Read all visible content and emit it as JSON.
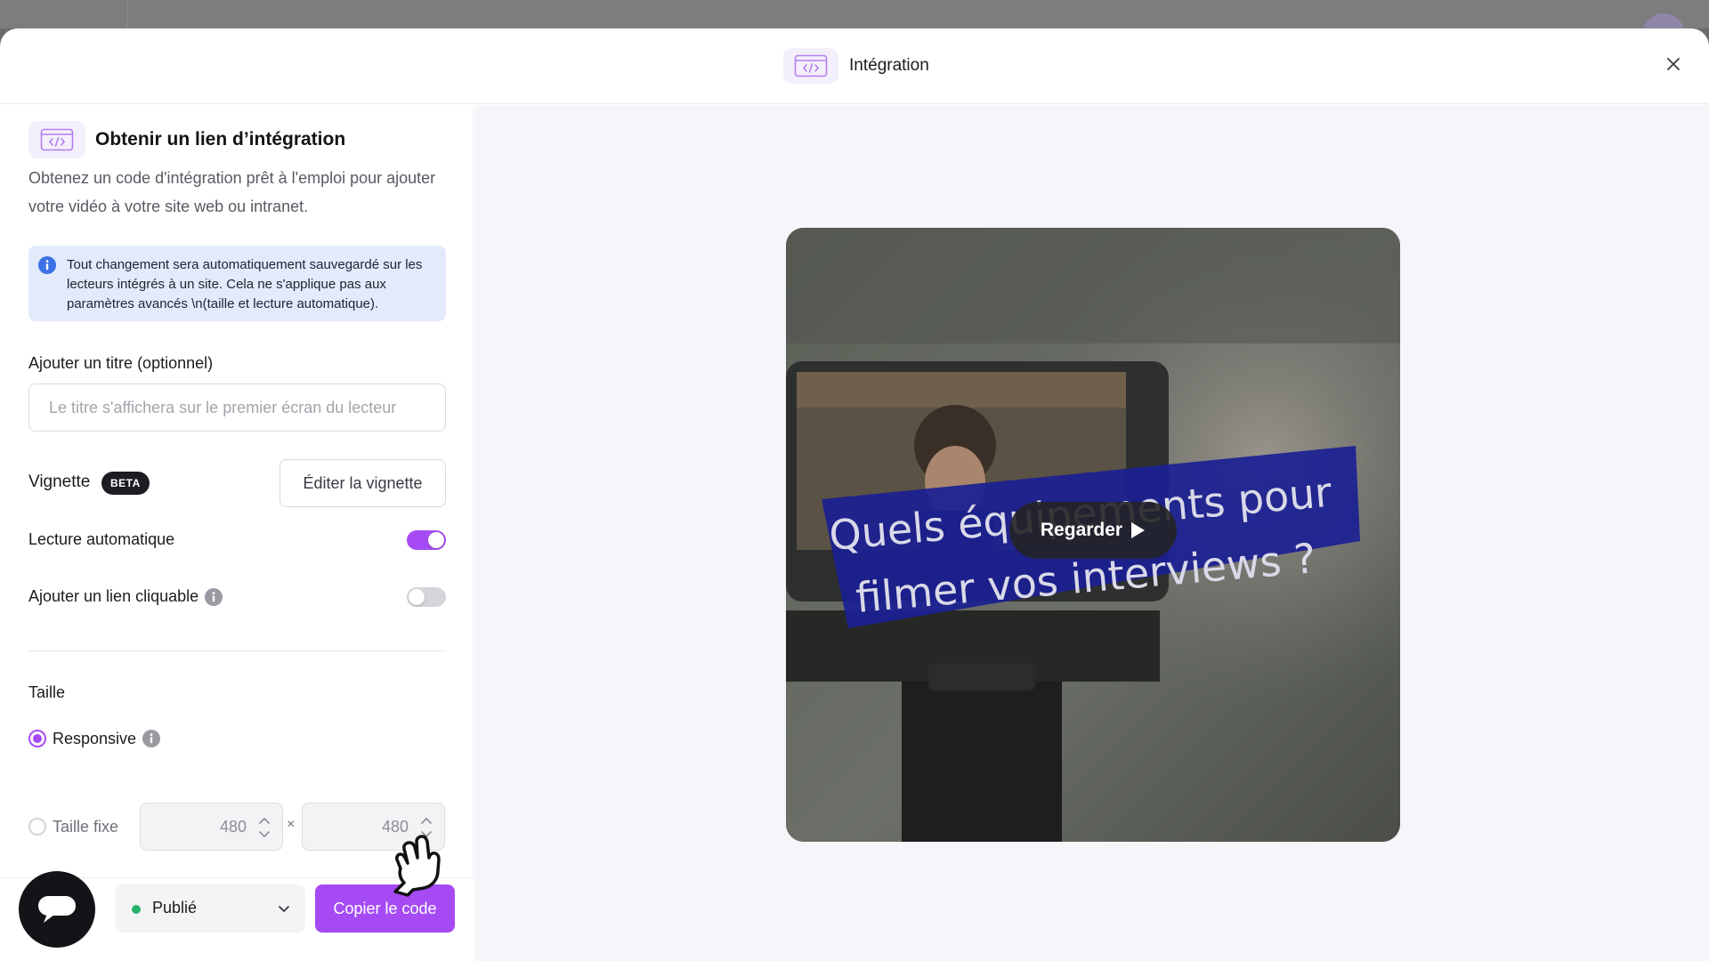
{
  "modal": {
    "title": "Intégration"
  },
  "section": {
    "title": "Obtenir un lien d’intégration",
    "description": "Obtenez un code d'intégration prêt à l'emploi pour ajouter votre vidéo à votre site web ou intranet."
  },
  "info_box": {
    "text": "Tout changement sera automatiquement sauvegardé sur les lecteurs intégrés à un site. Cela ne s'applique pas aux paramètres avancés \\n(taille et lecture automatique)."
  },
  "title_field": {
    "label": "Ajouter un titre (optionnel)",
    "placeholder": "Le titre s'affichera sur le premier écran du lecteur",
    "value": ""
  },
  "thumbnail": {
    "label": "Vignette",
    "badge": "BETA",
    "edit_button": "Éditer la vignette"
  },
  "autoplay": {
    "label": "Lecture automatique",
    "enabled": true
  },
  "clickable_link": {
    "label": "Ajouter un lien cliquable",
    "enabled": false
  },
  "size": {
    "label": "Taille",
    "options": {
      "responsive": "Responsive",
      "fixed": "Taille fixe"
    },
    "selected": "responsive",
    "width": "480",
    "height": "480",
    "separator": "×"
  },
  "footer": {
    "status": "Publié",
    "copy_button": "Copier le code"
  },
  "video": {
    "title_overlay_line1": "Quels équipements pour",
    "title_overlay_line2": "filmer vos interviews ?",
    "watch_button": "Regarder"
  },
  "colors": {
    "accent": "#a64bf4",
    "info_bg": "#e3eafb",
    "status_published": "#25b36b",
    "overlay_banner": "#1b1f93"
  },
  "icons": {
    "modal_header": "embed-code-icon",
    "close": "close-icon",
    "info": "info-icon",
    "chat": "chat-bubble-icon",
    "status_chevron": "chevron-down-icon",
    "cursor": "hand-pointer-icon",
    "play": "play-icon"
  }
}
